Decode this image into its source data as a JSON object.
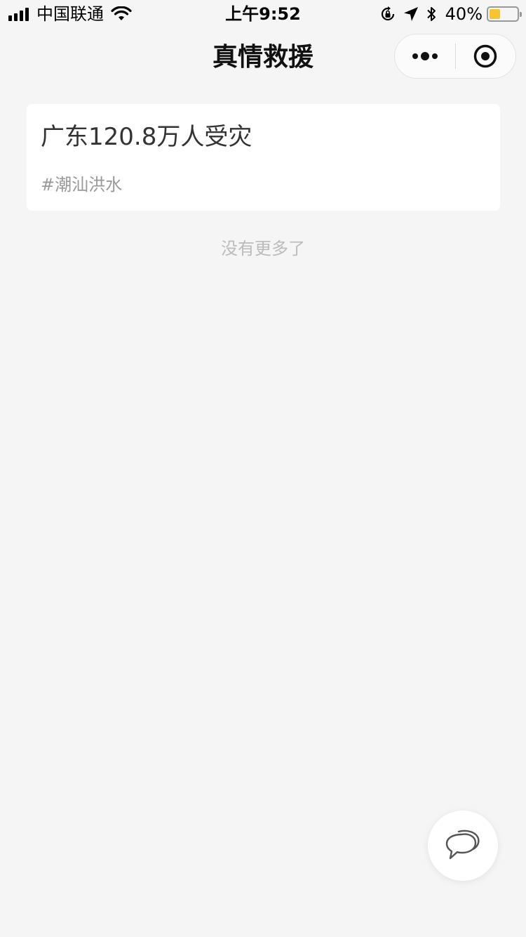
{
  "status_bar": {
    "carrier": "中国联通",
    "time": "上午9:52",
    "battery_percent": "40%",
    "battery_level": 0.4,
    "icons": [
      "signal-icon",
      "wifi-icon",
      "orientation-lock-icon",
      "location-arrow-icon",
      "bluetooth-icon",
      "battery-icon"
    ]
  },
  "nav": {
    "title": "真情救援",
    "capsule_icons": [
      "more-dots-icon",
      "close-target-icon"
    ]
  },
  "list": {
    "items": [
      {
        "title": "广东120.8万人受灾",
        "tag": "#潮汕洪水"
      }
    ],
    "end_text": "没有更多了"
  },
  "fab": {
    "icon": "chat-bubbles-icon"
  },
  "colors": {
    "background": "#f5f5f5",
    "card": "#ffffff",
    "battery_fill": "#f5c531",
    "muted_text": "#999999"
  }
}
